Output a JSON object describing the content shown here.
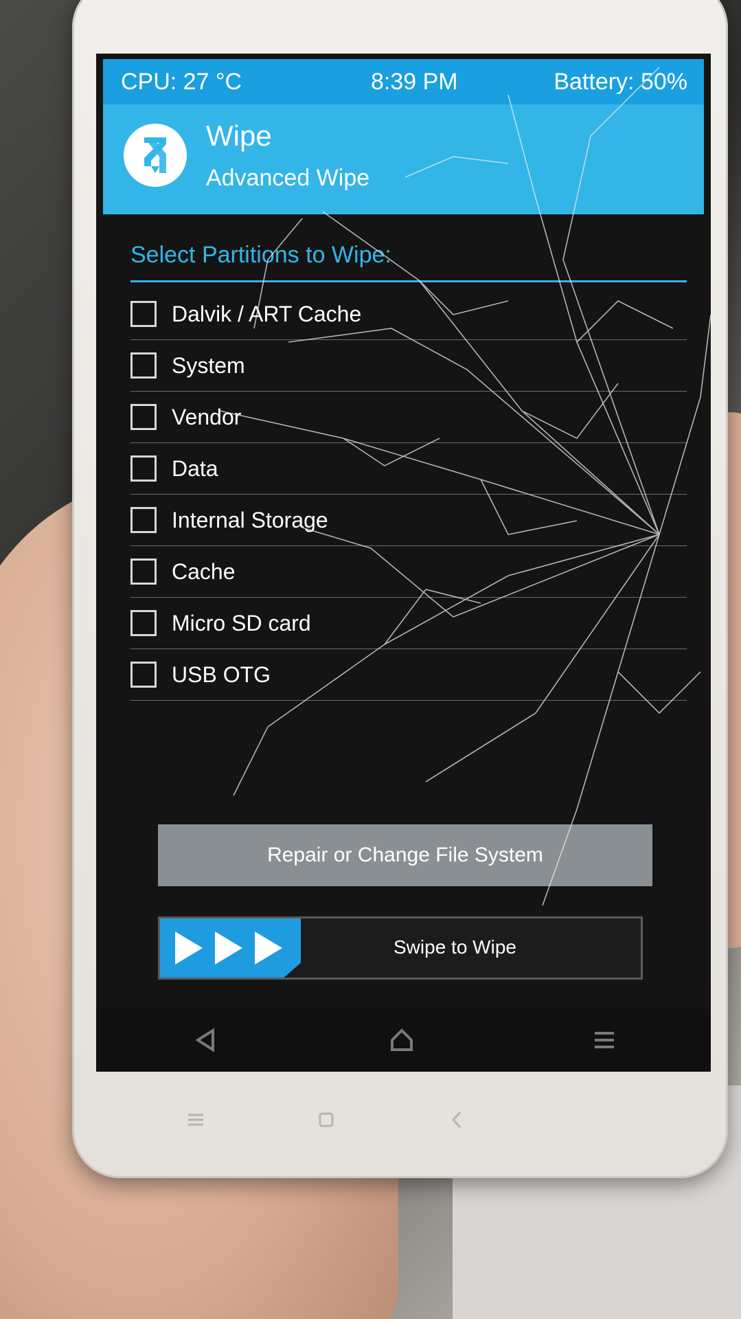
{
  "statusbar": {
    "cpu": "CPU: 27 °C",
    "time": "8:39 PM",
    "battery": "Battery: 50%"
  },
  "header": {
    "title": "Wipe",
    "subtitle": "Advanced Wipe",
    "logo_icon": "twrp-logo-icon"
  },
  "section": {
    "title": "Select Partitions to Wipe:"
  },
  "partitions": [
    {
      "label": "Dalvik / ART Cache",
      "checked": false
    },
    {
      "label": "System",
      "checked": false
    },
    {
      "label": "Vendor",
      "checked": false
    },
    {
      "label": "Data",
      "checked": false
    },
    {
      "label": "Internal Storage",
      "checked": false
    },
    {
      "label": "Cache",
      "checked": false
    },
    {
      "label": "Micro SD card",
      "checked": false
    },
    {
      "label": "USB OTG",
      "checked": false
    }
  ],
  "actions": {
    "repair_label": "Repair or Change File System",
    "swipe_label": "Swipe to Wipe"
  },
  "navbar": {
    "back_icon": "back-triangle-icon",
    "home_icon": "home-icon",
    "menu_icon": "menu-lines-icon"
  },
  "colors": {
    "accent": "#33b5e8",
    "statusbar": "#1a9fe0",
    "swipe_handle": "#1f9be0",
    "repair_button": "#8a8f94",
    "background": "#141414"
  }
}
